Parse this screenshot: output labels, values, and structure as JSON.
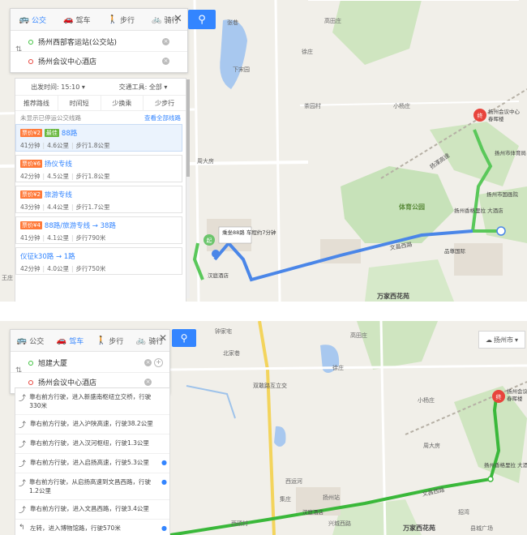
{
  "screen1": {
    "tabs": [
      {
        "label": "公交",
        "icon": "bus-icon",
        "active": true
      },
      {
        "label": "驾车",
        "icon": "car-icon",
        "active": false
      },
      {
        "label": "步行",
        "icon": "walk-icon",
        "active": false
      },
      {
        "label": "骑行",
        "icon": "bike-icon",
        "active": false
      }
    ],
    "start": "扬州西部客运站(公交站)",
    "end": "扬州会议中心酒店",
    "filters": {
      "depart": "出发时间: 15:10",
      "transport": "交通工具: 全部"
    },
    "subtabs": [
      "推荐路线",
      "时间短",
      "少换乘",
      "少步行"
    ],
    "notice": "未显示已停运公交线路",
    "notice_link": "查看全部线路",
    "routes": [
      {
        "price": "票价¥2",
        "fast": "最佳",
        "name": "88路",
        "time": "41分钟",
        "dist": "4.6公里",
        "walk": "步行1.8公里"
      },
      {
        "price": "票价¥6",
        "fast": "",
        "name": "扬仪专线",
        "time": "42分钟",
        "dist": "4.5公里",
        "walk": "步行1.8公里"
      },
      {
        "price": "票价¥2",
        "fast": "",
        "name": "旅游专线",
        "time": "43分钟",
        "dist": "4.4公里",
        "walk": "步行1.7公里"
      },
      {
        "price": "票价¥4",
        "fast": "",
        "name": "88路/旅游专线 → 38路",
        "time": "41分钟",
        "dist": "4.1公里",
        "walk": "步行790米"
      },
      {
        "price": "",
        "fast": "",
        "name": "仪征k30路 → 1路",
        "time": "42分钟",
        "dist": "4.0公里",
        "walk": "步行750米"
      }
    ],
    "map_labels": {
      "zhangjia": "张巷",
      "gaotian": "高田庄",
      "xuzhuang": "徐庄",
      "xiadian": "下宋园",
      "chaxi": "茶园村",
      "xiaoyang": "小杨庄",
      "hotel": "扬州会议中心",
      "hotel2": "春晖楼",
      "sportscenter": "扬州市体育局",
      "zhoudafang": "周大房",
      "expressway": "扬溧高速",
      "guodian": "扬州市国画院",
      "sportspark": "体育公园",
      "xiyuan": "扬州香格里拉\n大酒店",
      "wenchang": "文昌西路",
      "pinzun": "品尊国际",
      "hanting": "汉庭酒店",
      "wanjia": "万家西花苑",
      "wangzhuang": "王庄",
      "bus_info": "乘坐88路\n车程约7分钟",
      "start_marker": "起",
      "end_marker": "终"
    }
  },
  "screen2": {
    "tabs": [
      {
        "label": "公交",
        "icon": "bus-icon",
        "active": false
      },
      {
        "label": "驾车",
        "icon": "car-icon",
        "active": true
      },
      {
        "label": "步行",
        "icon": "walk-icon",
        "active": false
      },
      {
        "label": "骑行",
        "icon": "bike-icon",
        "active": false
      }
    ],
    "start": "旭建大厦",
    "end": "扬州会议中心酒店",
    "city": "扬州市",
    "steps": [
      "靠右前方行驶，进入新盛南枢纽立交桥，行驶330米",
      "靠右前方行驶，进入沪陕高速，行驶38.2公里",
      "靠右前方行驶，进入汉河枢纽，行驶1.3公里",
      "靠右前方行驶，进入启扬高速，行驶5.3公里",
      "靠右前方行驶，从启扬高速到文昌西路，行驶1.2公里",
      "靠右前方行驶，进入文昌西路，行驶3.4公里",
      "左转，进入博物馆路，行驶570米"
    ],
    "map_labels": {
      "zhongjia": "钟家宅",
      "gaotian": "高田庄",
      "beixin": "北家巷",
      "xuzhuang": "徐庄",
      "shuanggang": "双敢路互立交",
      "xiaoyang": "小杨庄",
      "zhoudafang": "周大房",
      "hotel": "扬州会议中心",
      "hotel2": "春晖楼",
      "xiyuan": "扬州香格里拉\n大酒店",
      "station": "扬州站",
      "wenchang": "文昌西路",
      "hanting": "汉庭酒店",
      "wanjia": "万家西花苑",
      "jiezhuang": "集庄",
      "xinggang": "西运河",
      "ximu": "西硕村",
      "xihua": "兴城西路",
      "zhaowan": "招湾",
      "beihai": "县城广场",
      "end_marker": "终"
    }
  }
}
